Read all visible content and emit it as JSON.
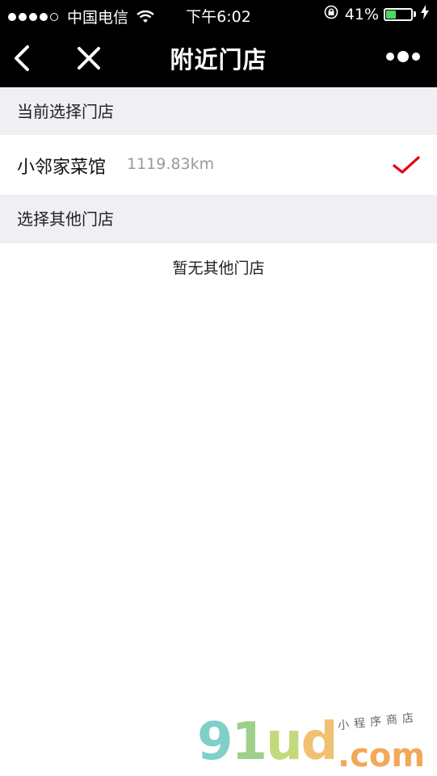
{
  "status_bar": {
    "carrier": "中国电信",
    "time": "下午6:02",
    "battery_text": "41%",
    "battery_level": 0.41,
    "signal_bars": 4
  },
  "nav": {
    "title": "附近门店"
  },
  "current_section": {
    "header": "当前选择门店",
    "store": {
      "name": "小邻家菜馆",
      "distance": "1119.83km",
      "check_color": "#e60012"
    }
  },
  "other_section": {
    "header": "选择其他门店",
    "empty_text": "暂无其他门店"
  },
  "watermark": {
    "brand": "91ud",
    "domain": ".com",
    "tagline": "小程序商店"
  }
}
